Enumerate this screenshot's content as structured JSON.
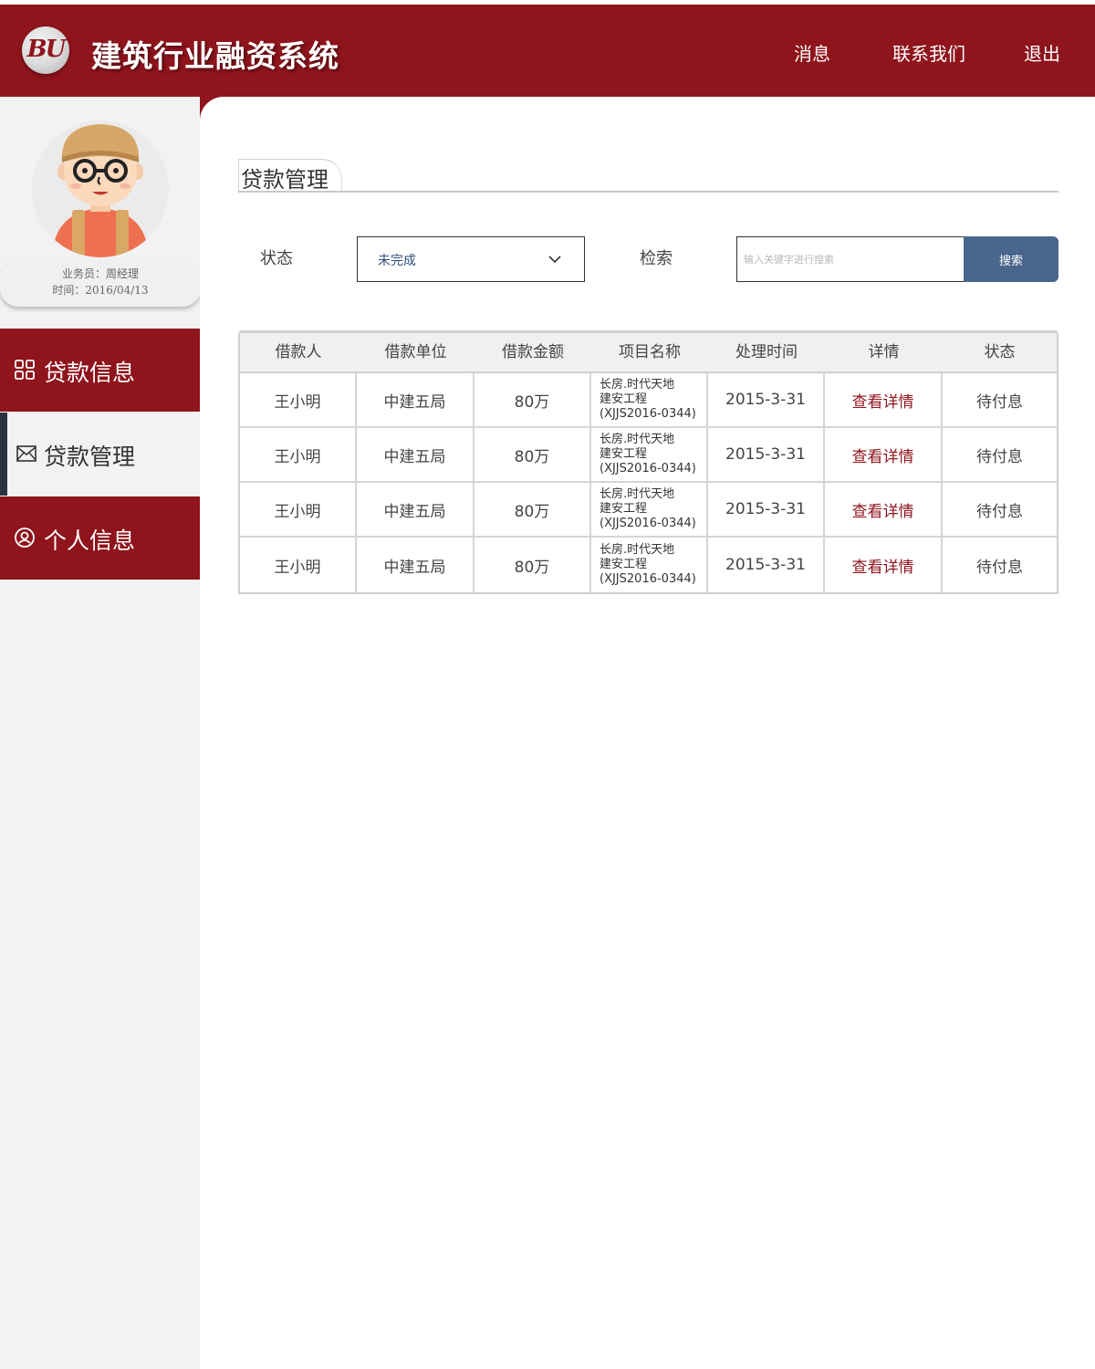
{
  "header": {
    "logo_text": "BU",
    "app_title": "建筑行业融资系统",
    "nav": {
      "messages": "消息",
      "contact": "联系我们",
      "logout": "退出"
    }
  },
  "sidebar": {
    "user": {
      "salesperson": "业务员：周经理",
      "date": "时间：2016/04/13"
    },
    "menu": [
      {
        "label": "贷款信息",
        "icon": "grid-icon"
      },
      {
        "label": "贷款管理",
        "icon": "mail-icon",
        "active": true
      },
      {
        "label": "个人信息",
        "icon": "user-icon"
      }
    ]
  },
  "main": {
    "page_title": "贷款管理",
    "filters": {
      "status_label": "状态",
      "status_value": "未完成",
      "search_label": "检索",
      "search_placeholder": "输入关键字进行搜索",
      "search_button": "搜索"
    },
    "table": {
      "columns": [
        "借款人",
        "借款单位",
        "借款金额",
        "项目名称",
        "处理时间",
        "详情",
        "状态"
      ],
      "rows": [
        {
          "borrower": "王小明",
          "unit": "中建五局",
          "amount": "80万",
          "project": [
            "长房.时代天地",
            "建安工程",
            "(XJJS2016-0344)"
          ],
          "time": "2015-3-31",
          "detail": "查看详情",
          "status": "待付息"
        },
        {
          "borrower": "王小明",
          "unit": "中建五局",
          "amount": "80万",
          "project": [
            "长房.时代天地",
            "建安工程",
            "(XJJS2016-0344)"
          ],
          "time": "2015-3-31",
          "detail": "查看详情",
          "status": "待付息"
        },
        {
          "borrower": "王小明",
          "unit": "中建五局",
          "amount": "80万",
          "project": [
            "长房.时代天地",
            "建安工程",
            "(XJJS2016-0344)"
          ],
          "time": "2015-3-31",
          "detail": "查看详情",
          "status": "待付息"
        },
        {
          "borrower": "王小明",
          "unit": "中建五局",
          "amount": "80万",
          "project": [
            "长房.时代天地",
            "建安工程",
            "(XJJS2016-0344)"
          ],
          "time": "2015-3-31",
          "detail": "查看详情",
          "status": "待付息"
        }
      ]
    }
  },
  "colors": {
    "brand_red": "#8f141c",
    "sidebar_bg": "#f2f2f2",
    "button_blue": "#49668c",
    "active_indicator": "#2b3240"
  }
}
